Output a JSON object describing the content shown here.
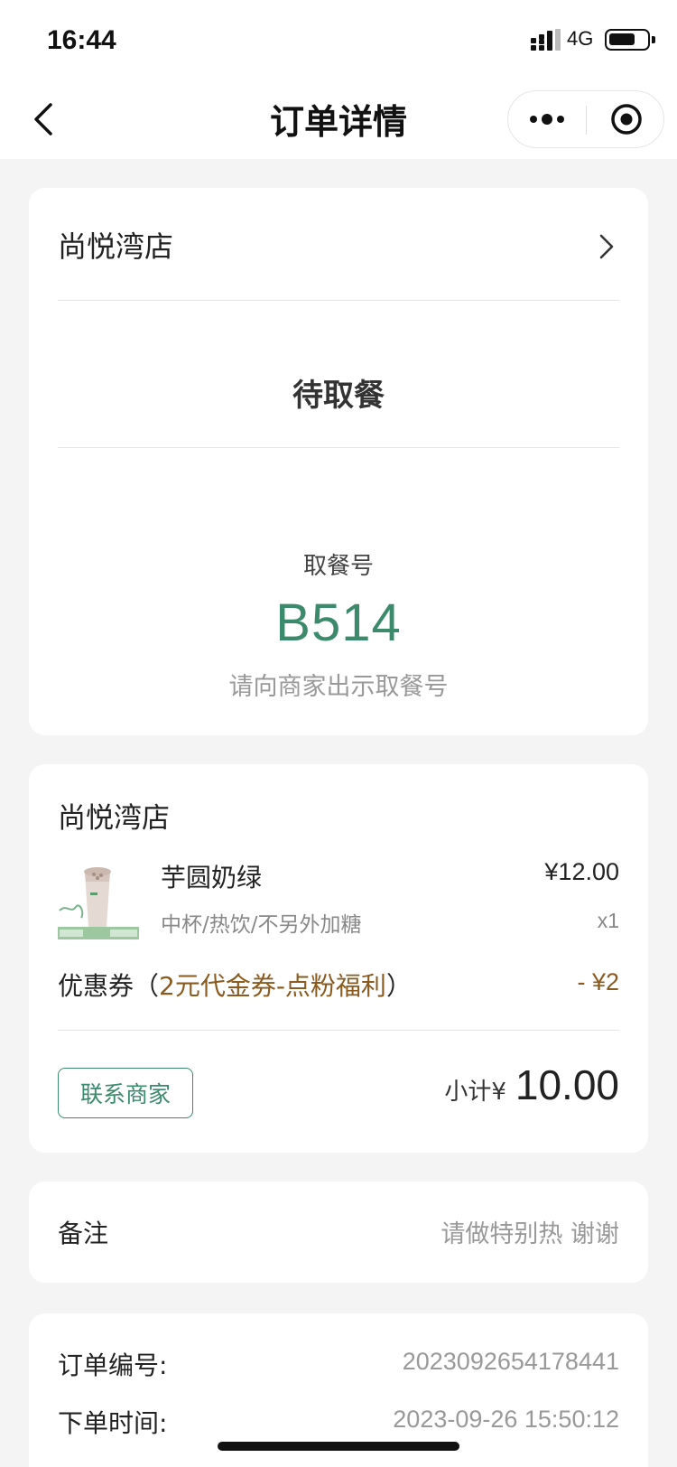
{
  "status_bar": {
    "time": "16:44",
    "network": "4G"
  },
  "nav": {
    "title": "订单详情",
    "back_icon": "chevron-left-icon",
    "more_icon": "more-dots-icon",
    "close_icon": "target-close-icon"
  },
  "order_status": {
    "store_name": "尚悦湾店",
    "status": "待取餐",
    "pickup_label": "取餐号",
    "pickup_number": "B514",
    "pickup_hint": "请向商家出示取餐号"
  },
  "order_items": {
    "store_name": "尚悦湾店",
    "items": [
      {
        "name": "芋圆奶绿",
        "price": "¥12.00",
        "spec": "中杯/热饮/不另外加糖",
        "quantity": "x1"
      }
    ],
    "coupon": {
      "label": "优惠券（",
      "name": "2元代金券-点粉福利",
      "close": "）",
      "amount": "- ¥2"
    },
    "contact_button": "联系商家",
    "subtotal_label": "小计¥",
    "subtotal_value": "10.00"
  },
  "remark": {
    "label": "备注",
    "value": "请做特别热 谢谢"
  },
  "order_info": {
    "rows": [
      {
        "label": "订单编号:",
        "value": "2023092654178441"
      },
      {
        "label": "下单时间:",
        "value": "2023-09-26 15:50:12"
      }
    ]
  },
  "colors": {
    "accent_green": "#3a8a6b",
    "coupon_brown": "#8a5a1e",
    "background": "#f4f4f4"
  }
}
